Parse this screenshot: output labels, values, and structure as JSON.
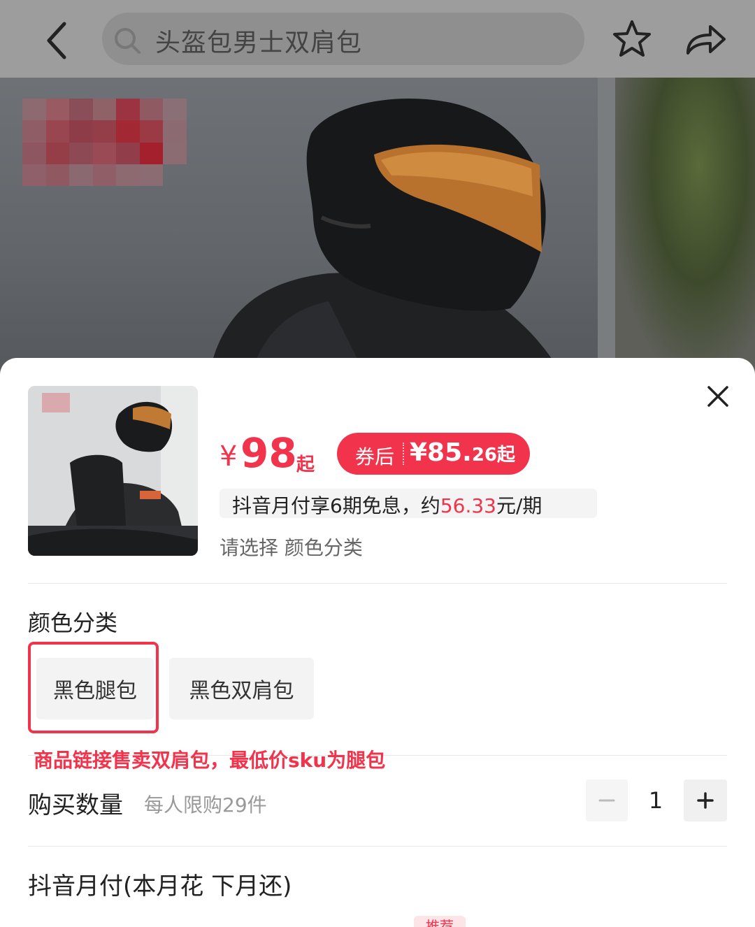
{
  "header": {
    "search_text": "头盔包男士双肩包",
    "icons": [
      "back-icon",
      "search-icon",
      "star-icon",
      "share-icon"
    ]
  },
  "product": {
    "price_currency": "¥",
    "price_value": "98",
    "price_suffix": "起",
    "coupon_label": "券后",
    "coupon_price_main": "¥85.",
    "coupon_price_decimal": "26",
    "coupon_price_suffix": "起",
    "installment_prefix": "抖音月付享6期免息，约",
    "installment_amount": "56.33",
    "installment_suffix": "元/期",
    "select_hint": "请选择 颜色分类"
  },
  "sku": {
    "section_title": "颜色分类",
    "options": [
      {
        "label": "黑色腿包",
        "highlighted": true
      },
      {
        "label": "黑色双肩包",
        "highlighted": false
      }
    ],
    "annotation": "商品链接售卖双肩包，最低价sku为腿包"
  },
  "quantity": {
    "label": "购买数量",
    "limit_text": "每人限购29件",
    "value": "1"
  },
  "payment": {
    "title": "抖音月付(本月花 下月还)",
    "tag": "推荐"
  },
  "colors": {
    "accent": "#f2334c",
    "sheet_bg": "#ffffff",
    "overlay": "#6d6d6d"
  }
}
